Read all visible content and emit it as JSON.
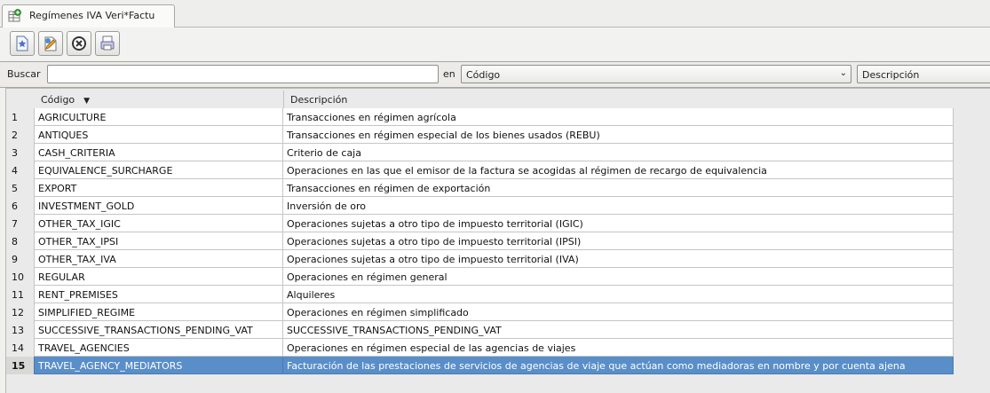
{
  "tab": {
    "title": "Regímenes IVA Veri*Factu"
  },
  "toolbar": {
    "buttons": [
      {
        "name": "new-record-icon"
      },
      {
        "name": "edit-record-icon"
      },
      {
        "name": "delete-record-icon"
      },
      {
        "name": "print-icon"
      }
    ]
  },
  "search": {
    "label": "Buscar",
    "value": "",
    "placeholder": "",
    "in_label": "en",
    "field_selected": "Código",
    "field_option_2": "Descripción"
  },
  "table": {
    "columns": [
      "Código",
      "Descripción"
    ],
    "sorted_column": "Código",
    "selected_row": 15,
    "rows": [
      {
        "num": "1",
        "code": "AGRICULTURE",
        "desc": "Transacciones en régimen agrícola"
      },
      {
        "num": "2",
        "code": "ANTIQUES",
        "desc": "Transacciones en régimen especial de los bienes usados (REBU)"
      },
      {
        "num": "3",
        "code": "CASH_CRITERIA",
        "desc": "Criterio de caja"
      },
      {
        "num": "4",
        "code": "EQUIVALENCE_SURCHARGE",
        "desc": "Operaciones en las que el emisor de la factura se acogidas al régimen de recargo de equivalencia"
      },
      {
        "num": "5",
        "code": "EXPORT",
        "desc": "Transacciones en régimen de exportación"
      },
      {
        "num": "6",
        "code": "INVESTMENT_GOLD",
        "desc": "Inversión de oro"
      },
      {
        "num": "7",
        "code": "OTHER_TAX_IGIC",
        "desc": "Operaciones sujetas a otro tipo de impuesto territorial (IGIC)"
      },
      {
        "num": "8",
        "code": "OTHER_TAX_IPSI",
        "desc": "Operaciones sujetas a otro tipo de impuesto territorial (IPSI)"
      },
      {
        "num": "9",
        "code": "OTHER_TAX_IVA",
        "desc": "Operaciones sujetas a otro tipo de impuesto territorial (IVA)"
      },
      {
        "num": "10",
        "code": "REGULAR",
        "desc": "Operaciones en régimen general"
      },
      {
        "num": "11",
        "code": "RENT_PREMISES",
        "desc": "Alquileres"
      },
      {
        "num": "12",
        "code": "SIMPLIFIED_REGIME",
        "desc": "Operaciones en régimen simplificado"
      },
      {
        "num": "13",
        "code": "SUCCESSIVE_TRANSACTIONS_PENDING_VAT",
        "desc": "SUCCESSIVE_TRANSACTIONS_PENDING_VAT"
      },
      {
        "num": "14",
        "code": "TRAVEL_AGENCIES",
        "desc": "Operaciones en régimen especial de las agencias de viajes"
      },
      {
        "num": "15",
        "code": "TRAVEL_AGENCY_MEDIATORS",
        "desc": "Facturación de las prestaciones de servicios de agencias de viaje que actúan como mediadoras en nombre y por cuenta ajena"
      }
    ]
  }
}
